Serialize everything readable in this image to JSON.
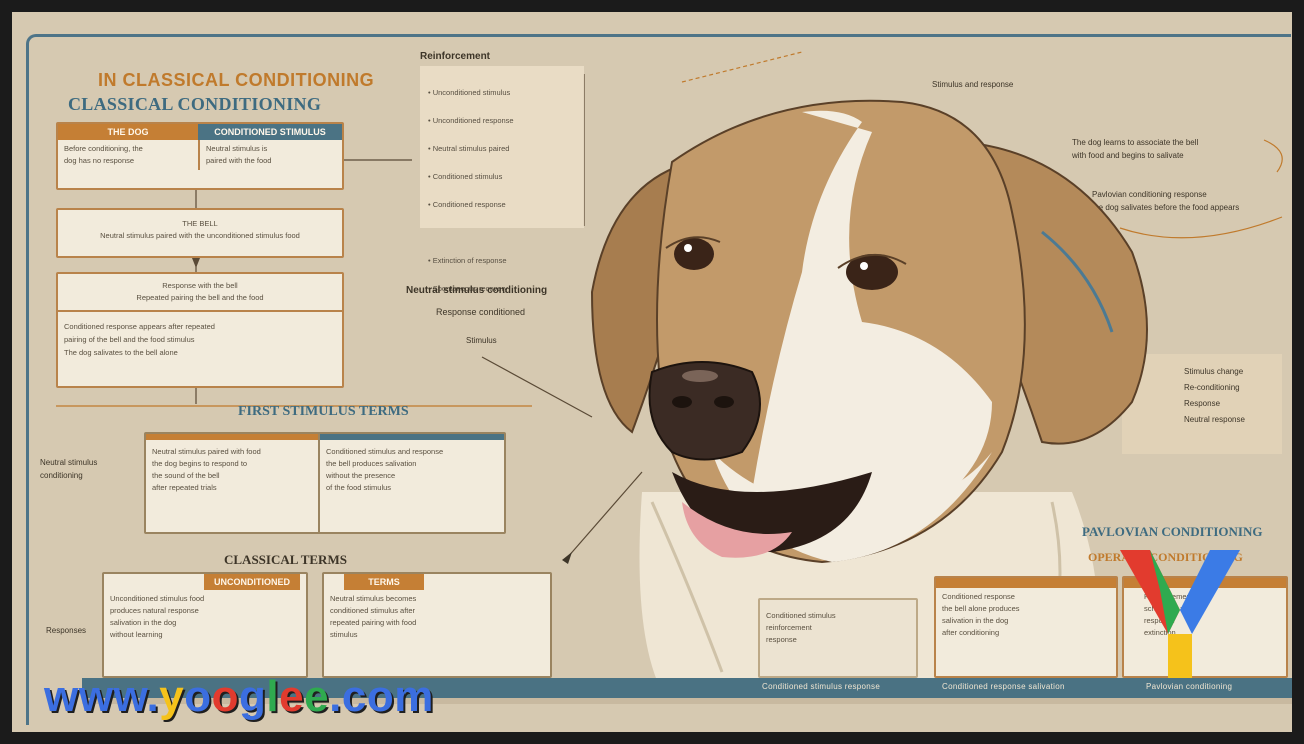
{
  "header": {
    "title_small": "IN CLASSICAL CONDITIONING",
    "title_main": "CLASSICAL CONDITIONING"
  },
  "left_cards": [
    {
      "header": "THE DOG",
      "text": "Before conditioning, the\ndog has no response"
    },
    {
      "header": "CONDITIONED STIMULUS",
      "text": "Neutral stimulus is\npaired with the food"
    },
    {
      "header": "",
      "text": "THE BELL\nNeutral stimulus paired with the unconditioned stimulus food"
    },
    {
      "header": "",
      "text": "Response with the bell\nRepeated pairing the bell and the food"
    },
    {
      "header": "",
      "text": "Conditioned response appears after repeated\npairing of the bell and the food stimulus\nThe dog salivates to the bell alone"
    }
  ],
  "top_list": {
    "heading": "Reinforcement",
    "items": [
      "• Unconditioned stimulus",
      "• Unconditioned response",
      "• Neutral stimulus paired",
      "• Conditioned stimulus",
      "• Conditioned response"
    ],
    "items2": [
      "• Extinction of response",
      "• Spontaneous recovery"
    ]
  },
  "side_labels": {
    "mid_right": "Neutral stimulus conditioning",
    "mid_right2": "Response conditioned",
    "mid_right3": "Stimulus",
    "top_right": "Stimulus and response",
    "right_para1": "The dog learns to associate the bell\nwith food and begins to salivate",
    "right_para2": "Pavlovian conditioning response\nthe dog salivates before the food appears",
    "right_small": "Stimulus change\nRe-conditioning\nResponse\nNeutral response",
    "left_side": "Neutral stimulus\nconditioning",
    "left_bottom": "Responses"
  },
  "mid_section": {
    "title": "FIRST STIMULUS TERMS",
    "cards": [
      {
        "header": "",
        "text": "Neutral stimulus paired with food\nthe dog begins to respond to\nthe sound of the bell\nafter repeated trials"
      },
      {
        "header": "",
        "text": "Conditioned stimulus and response\nthe bell produces salivation\nwithout the presence\nof the food stimulus"
      }
    ]
  },
  "bottom_section": {
    "title": "CLASSICAL TERMS",
    "cards": [
      {
        "header": "UNCONDITIONED",
        "text": "Unconditioned stimulus food\nproduces natural response\nsalivation in the dog\nwithout learning"
      },
      {
        "header": "TERMS",
        "text": "Neutral stimulus becomes\nconditioned stimulus after\nrepeated pairing with food\nstimulus"
      }
    ]
  },
  "right_section": {
    "title": "PAVLOVIAN CONDITIONING",
    "subtitle": "OPERANT CONDITIONING",
    "cards": [
      {
        "text": "Conditioned stimulus\nreinforcement\nresponse"
      },
      {
        "text": "Conditioned response\nthe bell alone produces\nsalivation in the dog\nafter conditioning"
      },
      {
        "text": "Reinforcement\nschedules and\nresponse\nextinction"
      }
    ]
  },
  "bottom_bar": [
    "Conditioned stimulus response",
    "Conditioned response salivation",
    "Pavlovian conditioning"
  ],
  "watermark": {
    "www": "www.",
    "y": "y",
    "o1": "o",
    "o2": "o",
    "g": "g",
    "l": "l",
    "e": "e",
    "e2": "e",
    "dot": ".",
    "com": "com"
  },
  "colors": {
    "background": "#d6c9b1",
    "accent_orange": "#c57f35",
    "accent_teal": "#4b7384",
    "dog_fur": "#bf9a6c",
    "dog_white": "#f3ede1"
  }
}
